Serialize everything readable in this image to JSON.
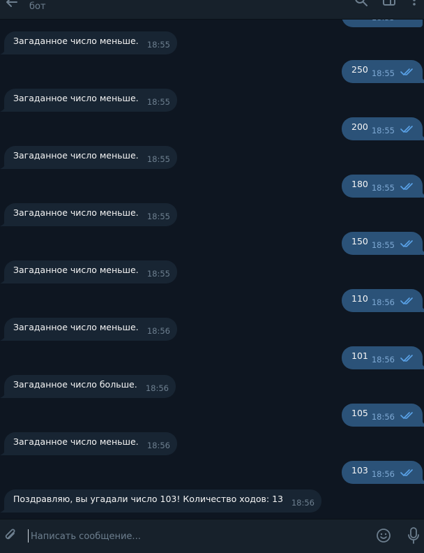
{
  "header": {
    "subtitle": "бот",
    "icons": [
      "back-arrow-icon",
      "search-icon",
      "columns-icon",
      "more-icon"
    ]
  },
  "colors": {
    "background": "#0e1621",
    "incoming_bubble": "#182533",
    "outgoing_bubble": "#2b5278",
    "header": "#17212b",
    "read_check": "#5aa2e8"
  },
  "top_partial_message": {
    "time": "18:55"
  },
  "messages": [
    {
      "dir": "in",
      "text": "Загаданное число меньше.",
      "time": "18:55"
    },
    {
      "dir": "out",
      "text": "250",
      "time": "18:55",
      "status": "read"
    },
    {
      "dir": "in",
      "text": "Загаданное число меньше.",
      "time": "18:55"
    },
    {
      "dir": "out",
      "text": "200",
      "time": "18:55",
      "status": "read"
    },
    {
      "dir": "in",
      "text": "Загаданное число меньше.",
      "time": "18:55"
    },
    {
      "dir": "out",
      "text": "180",
      "time": "18:55",
      "status": "read"
    },
    {
      "dir": "in",
      "text": "Загаданное число меньше.",
      "time": "18:55"
    },
    {
      "dir": "out",
      "text": "150",
      "time": "18:55",
      "status": "read"
    },
    {
      "dir": "in",
      "text": "Загаданное число меньше.",
      "time": "18:55"
    },
    {
      "dir": "out",
      "text": "110",
      "time": "18:56",
      "status": "read"
    },
    {
      "dir": "in",
      "text": "Загаданное число меньше.",
      "time": "18:56"
    },
    {
      "dir": "out",
      "text": "101",
      "time": "18:56",
      "status": "read"
    },
    {
      "dir": "in",
      "text": "Загаданное число больше.",
      "time": "18:56"
    },
    {
      "dir": "out",
      "text": "105",
      "time": "18:56",
      "status": "read"
    },
    {
      "dir": "in",
      "text": "Загаданное число меньше.",
      "time": "18:56"
    },
    {
      "dir": "out",
      "text": "103",
      "time": "18:56",
      "status": "read"
    },
    {
      "dir": "in",
      "text": "Поздравляю, вы угадали число 103! Количество ходов: 13",
      "time": "18:56"
    }
  ],
  "composer": {
    "placeholder": "Написать сообщение...",
    "icons": [
      "paperclip-icon",
      "emoji-icon",
      "microphone-icon"
    ]
  }
}
